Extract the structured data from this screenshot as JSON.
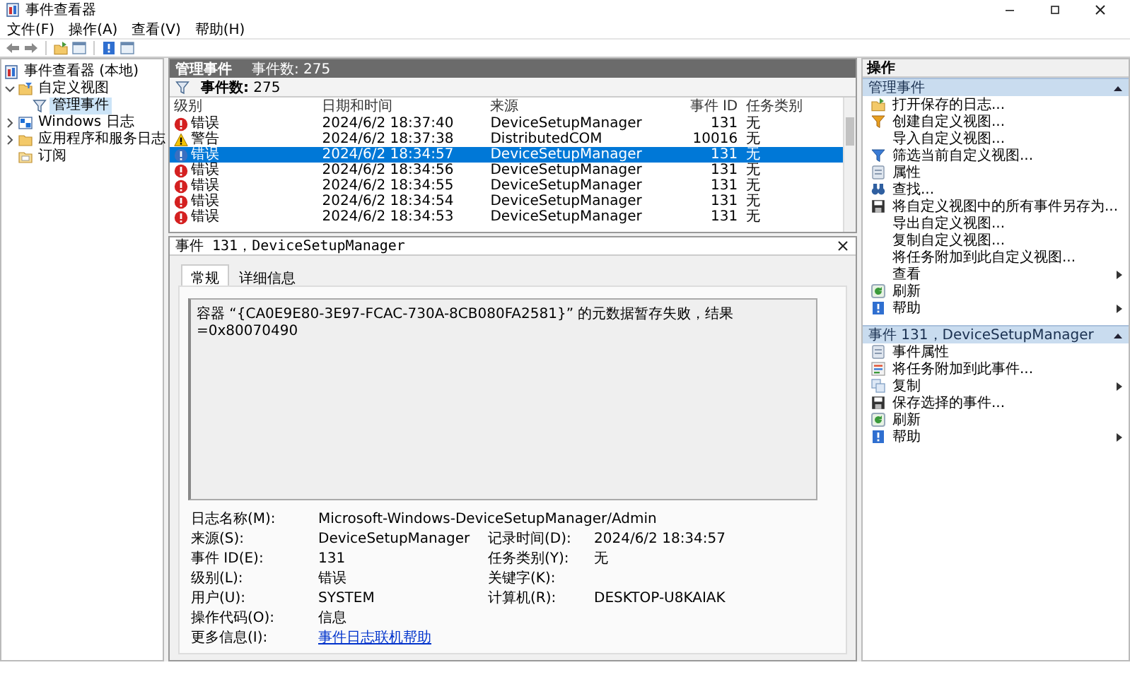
{
  "window": {
    "title": "事件查看器"
  },
  "menu": [
    "文件(F)",
    "操作(A)",
    "查看(V)",
    "帮助(H)"
  ],
  "tree": [
    {
      "label": "事件查看器 (本地)",
      "kind": "viewer",
      "selected": false,
      "children": [
        {
          "label": "自定义视图",
          "kind": "folder-filter",
          "expanded": true,
          "selected": false,
          "children": [
            {
              "label": "管理事件",
              "kind": "filter",
              "selected": true
            }
          ]
        },
        {
          "label": "Windows 日志",
          "kind": "windows",
          "expanded": false,
          "selected": false
        },
        {
          "label": "应用程序和服务日志",
          "kind": "folder",
          "expanded": false,
          "selected": false
        },
        {
          "label": "订阅",
          "kind": "subscription",
          "selected": false
        }
      ]
    }
  ],
  "panel": {
    "title": "管理事件",
    "count": "事件数: 275"
  },
  "filter_bar": {
    "text": "**事件数:** 275"
  },
  "table": {
    "columns": [
      "级别",
      "日期和时间",
      "来源",
      "事件 ID",
      "任务类别"
    ],
    "rows": [
      {
        "kind": "error",
        "level": "错误",
        "time": "2024/6/2 18:37:40",
        "source": "DeviceSetupManager",
        "event_id": "131",
        "category": "无",
        "selected": false
      },
      {
        "kind": "warning",
        "level": "警告",
        "time": "2024/6/2 18:37:38",
        "source": "DistributedCOM",
        "event_id": "10016",
        "category": "无",
        "selected": false
      },
      {
        "kind": "error",
        "level": "错误",
        "time": "2024/6/2 18:34:57",
        "source": "DeviceSetupManager",
        "event_id": "131",
        "category": "无",
        "selected": true
      },
      {
        "kind": "error",
        "level": "错误",
        "time": "2024/6/2 18:34:56",
        "source": "DeviceSetupManager",
        "event_id": "131",
        "category": "无",
        "selected": false
      },
      {
        "kind": "error",
        "level": "错误",
        "time": "2024/6/2 18:34:55",
        "source": "DeviceSetupManager",
        "event_id": "131",
        "category": "无",
        "selected": false
      },
      {
        "kind": "error",
        "level": "错误",
        "time": "2024/6/2 18:34:54",
        "source": "DeviceSetupManager",
        "event_id": "131",
        "category": "无",
        "selected": false
      },
      {
        "kind": "error",
        "level": "错误",
        "time": "2024/6/2 18:34:53",
        "source": "DeviceSetupManager",
        "event_id": "131",
        "category": "无",
        "selected": false
      }
    ]
  },
  "detail": {
    "title": "事件 131，DeviceSetupManager",
    "tabs": [
      {
        "label": "常规",
        "selected": true
      },
      {
        "label": "详细信息",
        "selected": false
      }
    ],
    "message": "容器 “{CA0E9E80-3E97-FCAC-730A-8CB080FA2581}” 的元数据暂存失败，结果=0x80070490",
    "fields": [
      [
        {
          "label": "日志名称(M):",
          "value": "Microsoft-Windows-DeviceSetupManager/Admin"
        }
      ],
      [
        {
          "label": "来源(S):",
          "value": "DeviceSetupManager"
        },
        {
          "label": "记录时间(D):",
          "value": "2024/6/2 18:34:57"
        }
      ],
      [
        {
          "label": "事件 ID(E):",
          "value": "131"
        },
        {
          "label": "任务类别(Y):",
          "value": "无"
        }
      ],
      [
        {
          "label": "级别(L):",
          "value": "错误"
        },
        {
          "label": "关键字(K):"
        }
      ],
      [
        {
          "label": "用户(U):",
          "value": "SYSTEM"
        },
        {
          "label": "计算机(R):",
          "value": "DESKTOP-U8KAIAK"
        }
      ],
      [
        {
          "label": "操作代码(O):",
          "value": "信息"
        }
      ],
      [
        {
          "label": "更多信息(I):",
          "value": "事件日志联机帮助",
          "kind": "link"
        }
      ]
    ]
  },
  "actions": {
    "title": "操作",
    "sections": [
      {
        "title": "管理事件",
        "items": [
          {
            "label": "打开保存的日志...",
            "kind": "open"
          },
          {
            "label": "创建自定义视图...",
            "kind": "funnel-orange"
          },
          {
            "label": "导入自定义视图..."
          },
          {
            "label": "筛选当前自定义视图...",
            "kind": "funnel"
          },
          {
            "label": "属性",
            "kind": "sheet"
          },
          {
            "label": "查找...",
            "kind": "find"
          },
          {
            "label": "将自定义视图中的所有事件另存为...",
            "kind": "save"
          },
          {
            "label": "导出自定义视图..."
          },
          {
            "label": "复制自定义视图..."
          },
          {
            "label": "将任务附加到此自定义视图..."
          },
          {
            "label": "查看",
            "submenu": true
          },
          {
            "label": "刷新",
            "kind": "refresh"
          },
          {
            "label": "帮助",
            "kind": "help",
            "submenu": true
          }
        ]
      },
      {
        "title": "事件 131，DeviceSetupManager",
        "items": [
          {
            "label": "事件属性",
            "kind": "sheet"
          },
          {
            "label": "将任务附加到此事件...",
            "kind": "task"
          },
          {
            "label": "复制",
            "kind": "copy",
            "submenu": true
          },
          {
            "label": "保存选择的事件...",
            "kind": "save"
          },
          {
            "label": "刷新",
            "kind": "refresh"
          },
          {
            "label": "帮助",
            "kind": "help",
            "submenu": true
          }
        ]
      }
    ]
  }
}
